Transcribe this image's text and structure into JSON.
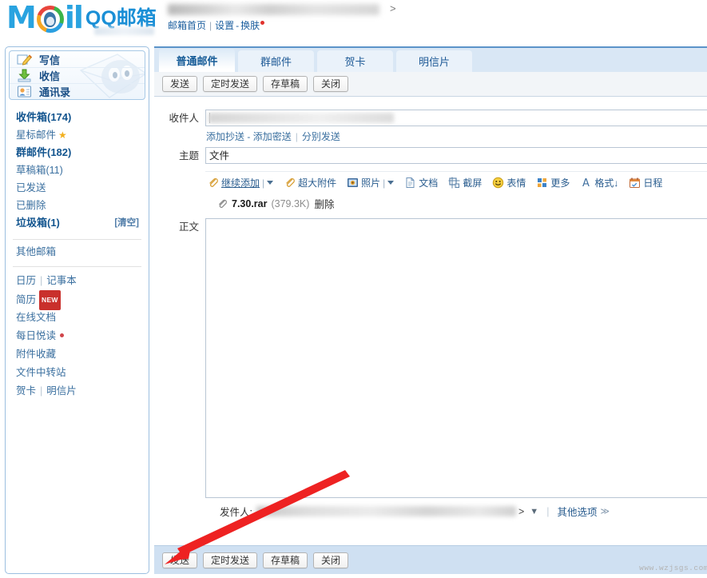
{
  "header": {
    "logo_mail": "Mail",
    "logo_brand": "QQ邮箱",
    "account_masked": "",
    "links": {
      "home": "邮箱首页",
      "separator": "|",
      "settings": "设置",
      "dash": "-",
      "skin": "换肤"
    }
  },
  "sidebar": {
    "nav": [
      {
        "label": "写信",
        "icon": "compose-icon"
      },
      {
        "label": "收信",
        "icon": "receive-icon"
      },
      {
        "label": "通讯录",
        "icon": "contacts-icon"
      }
    ],
    "folders": [
      {
        "label": "收件箱(174)",
        "bold": true,
        "action": ""
      },
      {
        "label": "星标邮件",
        "bold": false,
        "star": true,
        "action": ""
      },
      {
        "label": "群邮件(182)",
        "bold": true,
        "action": ""
      },
      {
        "label": "草稿箱(11)",
        "bold": false,
        "action": ""
      },
      {
        "label": "已发送",
        "bold": false,
        "action": ""
      },
      {
        "label": "已删除",
        "bold": false,
        "action": ""
      },
      {
        "label": "垃圾箱(1)",
        "bold": true,
        "action": "[清空]"
      }
    ],
    "other_mailbox": "其他邮箱",
    "links": [
      {
        "label": "日历",
        "label2": "记事本",
        "sep": "|"
      },
      {
        "label": "简历",
        "badge": "NEW"
      },
      {
        "label": "在线文档"
      },
      {
        "label": "每日悦读",
        "dot": true
      },
      {
        "label": "附件收藏"
      },
      {
        "label": "文件中转站"
      },
      {
        "label": "贺卡",
        "label2": "明信片",
        "sep": "|"
      }
    ]
  },
  "main": {
    "tabs": [
      {
        "label": "普通邮件",
        "active": true
      },
      {
        "label": "群邮件",
        "active": false
      },
      {
        "label": "贺卡",
        "active": false
      },
      {
        "label": "明信片",
        "active": false
      }
    ],
    "toolbar_buttons": [
      "发送",
      "定时发送",
      "存草稿",
      "关闭"
    ],
    "fields": {
      "to_label": "收件人",
      "to_value": "",
      "subject_label": "主题",
      "subject_value": "文件",
      "body_label": "正文",
      "body_value": ""
    },
    "sublinks": {
      "add_cc": "添加抄送",
      "dash": "-",
      "add_bcc": "添加密送",
      "vbar": "|",
      "send_separately": "分别发送"
    },
    "attach_toolbar": [
      {
        "label": "继续添加",
        "icon": "paperclip-icon",
        "underline": true,
        "caret": true
      },
      {
        "label": "超大附件",
        "icon": "paperclip-icon",
        "underline": false,
        "caret": false
      },
      {
        "label": "照片",
        "icon": "photo-icon",
        "underline": false,
        "caret": true
      },
      {
        "label": "文档",
        "icon": "document-icon",
        "underline": false,
        "caret": false
      },
      {
        "label": "截屏",
        "icon": "screenshot-icon",
        "underline": false,
        "caret": false
      },
      {
        "label": "表情",
        "icon": "emoji-icon",
        "underline": false,
        "caret": false
      },
      {
        "label": "更多",
        "icon": "more-grid-icon",
        "underline": false,
        "caret": false
      },
      {
        "label": "格式↓",
        "icon": "format-A-icon",
        "underline": false,
        "caret": false
      },
      {
        "label": "日程",
        "icon": "calendar-icon",
        "underline": false,
        "caret": false
      }
    ],
    "attachment": {
      "icon": "paperclip-icon",
      "name": "7.30.rar",
      "size": "(379.3K)",
      "delete": "删除"
    },
    "sender": {
      "label": "发件人:",
      "value_masked": "",
      "gt": ">",
      "caret": "▼",
      "vbar": "|",
      "other_options": "其他选项",
      "chevron": "≫"
    },
    "footer_buttons": [
      "发送",
      "定时发送",
      "存草稿",
      "关闭"
    ]
  },
  "watermark": "www.wzjsgs.com"
}
